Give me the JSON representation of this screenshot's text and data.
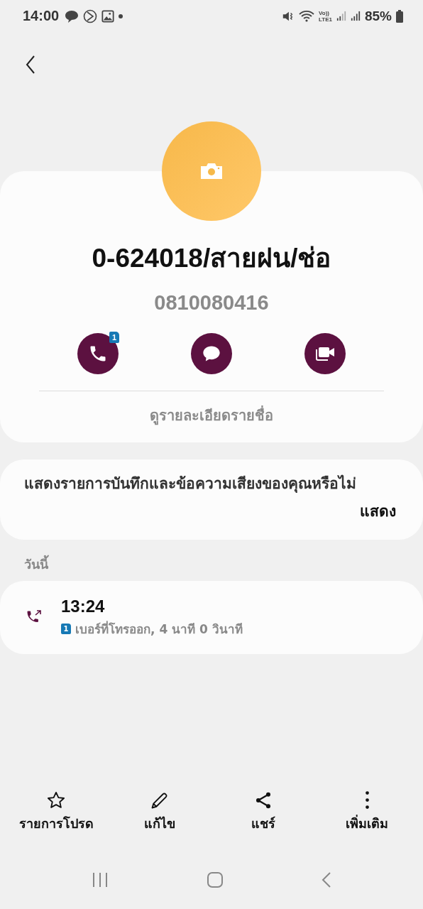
{
  "status_bar": {
    "time": "14:00",
    "network": "Vo))\nLTE1",
    "battery": "85%"
  },
  "contact": {
    "name": "0-624018/สายฝน/ช่อ",
    "number": "0810080416",
    "call_badge": "1",
    "details_link": "ดูรายละเอียดรายชื่อ"
  },
  "recording_prompt": {
    "text": "แสดงรายการบันทึกและข้อความเสียงของคุณหรือไม่",
    "action": "แสดง"
  },
  "history": {
    "section": "วันนี้",
    "calls": [
      {
        "kind": "outgoing",
        "time": "13:24",
        "sim": "1",
        "detail": "เบอร์ที่โทรออก, 4 นาที 0 วินาที"
      }
    ]
  },
  "bottom_actions": [
    {
      "kind": "favorite",
      "label": "รายการโปรด"
    },
    {
      "kind": "edit",
      "label": "แก้ไข"
    },
    {
      "kind": "share",
      "label": "แชร์"
    },
    {
      "kind": "more",
      "label": "เพิ่มเติม"
    }
  ]
}
